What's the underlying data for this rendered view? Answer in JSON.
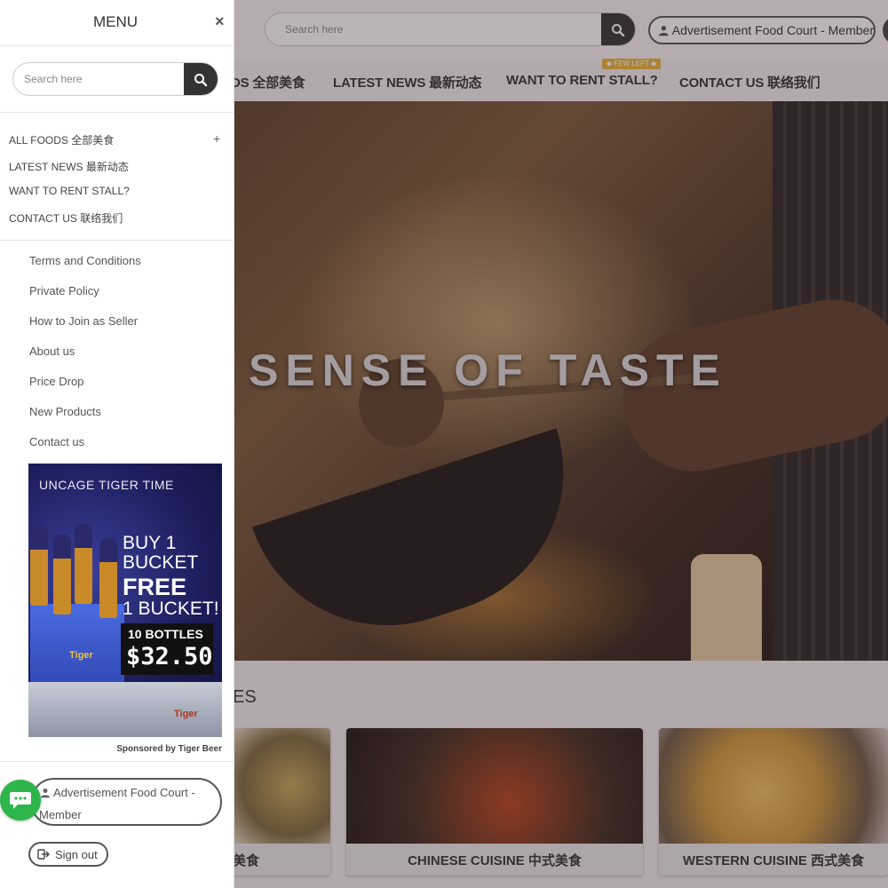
{
  "header": {
    "search_placeholder": "Search here",
    "member_label": "Advertisement Food Court - Member"
  },
  "nav": {
    "items": [
      {
        "label": "DS 全部美食"
      },
      {
        "label": "LATEST NEWS 最新动态"
      },
      {
        "label": "WANT TO RENT STALL?"
      },
      {
        "label": "CONTACT US 联络我们"
      }
    ],
    "badge": "◆ FEW LEFT ◆"
  },
  "hero": {
    "title": "SENSE OF TASTE"
  },
  "section": {
    "heading": "ES"
  },
  "cards": [
    {
      "label": "美食"
    },
    {
      "label": "CHINESE CUISINE 中式美食"
    },
    {
      "label": "WESTERN CUISINE 西式美食"
    }
  ],
  "side_menu": {
    "title": "MENU",
    "close": "×",
    "search_placeholder": "Search here",
    "categories": [
      {
        "label": "ALL FOODS 全部美食"
      },
      {
        "label": "LATEST NEWS 最新动态"
      },
      {
        "label": "WANT TO RENT STALL?"
      },
      {
        "label": "CONTACT US 联络我们"
      }
    ],
    "expand": "+",
    "links": [
      {
        "label": "Terms and Conditions"
      },
      {
        "label": "Private Policy"
      },
      {
        "label": "How to Join as Seller"
      },
      {
        "label": "About us"
      },
      {
        "label": "Price Drop"
      },
      {
        "label": "New Products"
      },
      {
        "label": "Contact us"
      }
    ],
    "ad": {
      "headline": "UNCAGE TIGER TIME",
      "buy": "BUY 1",
      "bucket": "BUCKET",
      "free": "FREE",
      "bucket2": "1 BUCKET!",
      "bottles": "10 BOTTLES",
      "price": "$32.50",
      "brand": "Tiger"
    },
    "sponsor": "Sponsored by Tiger Beer",
    "member_line1": "Advertisement Food Court -",
    "member_line2": "Member",
    "signout": "Sign out"
  },
  "colors": {
    "dark_button": "#333333",
    "badge": "#e9b43a",
    "chat_green": "#2fb64a"
  }
}
